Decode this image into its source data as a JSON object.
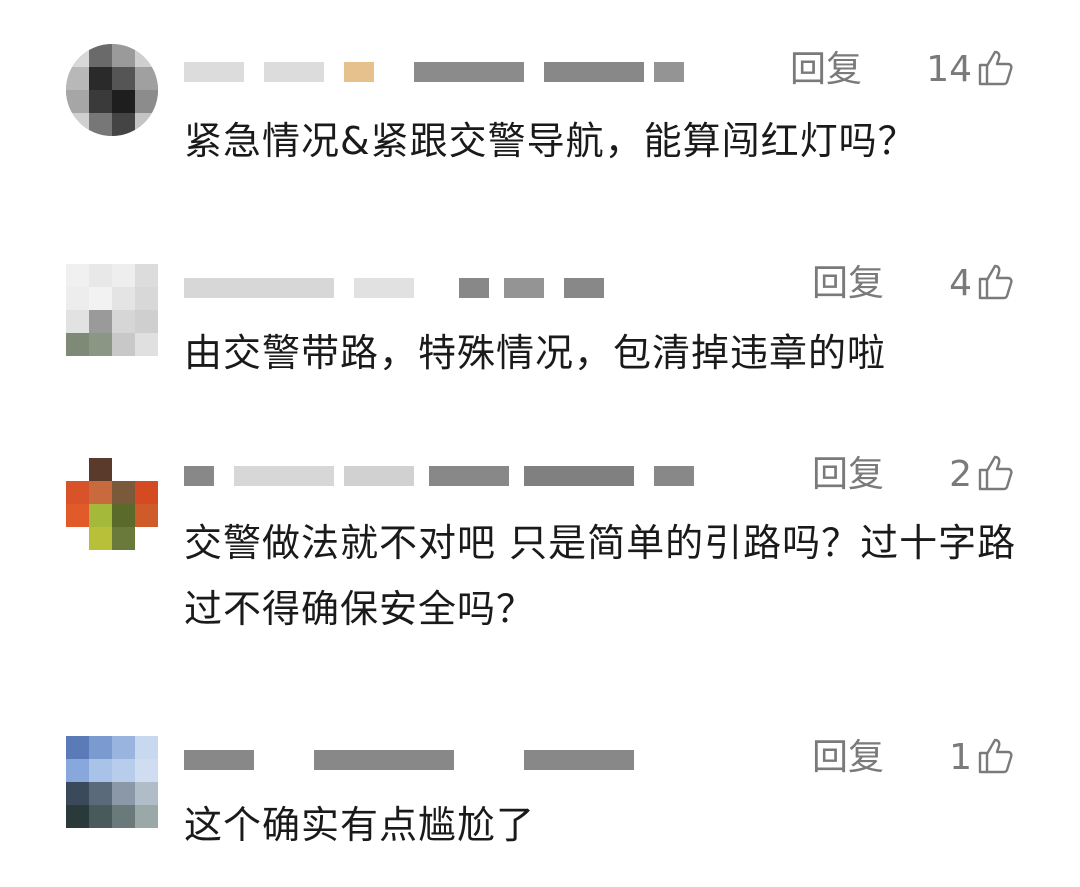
{
  "comments": [
    {
      "reply_label": "回复",
      "likes": "14",
      "text": "紧急情况&紧跟交警导航，能算闯红灯吗？",
      "avatar_icon": "pixelated-avatar"
    },
    {
      "reply_label": "回复",
      "likes": "4",
      "text": "由交警带路，特殊情况，包清掉违章的啦",
      "avatar_icon": "pixelated-avatar"
    },
    {
      "reply_label": "回复",
      "likes": "2",
      "text": "交警做法就不对吧 只是简单的引路吗？过十字路过不得确保安全吗？",
      "avatar_icon": "pixelated-avatar"
    },
    {
      "reply_label": "回复",
      "likes": "1",
      "text": "这个确实有点尴尬了",
      "avatar_icon": "pixelated-avatar"
    }
  ],
  "icons": {
    "like": "thumbs-up-icon"
  },
  "colors": {
    "meta_text": "#7a7a7a",
    "body_text": "#1a1a1a"
  }
}
